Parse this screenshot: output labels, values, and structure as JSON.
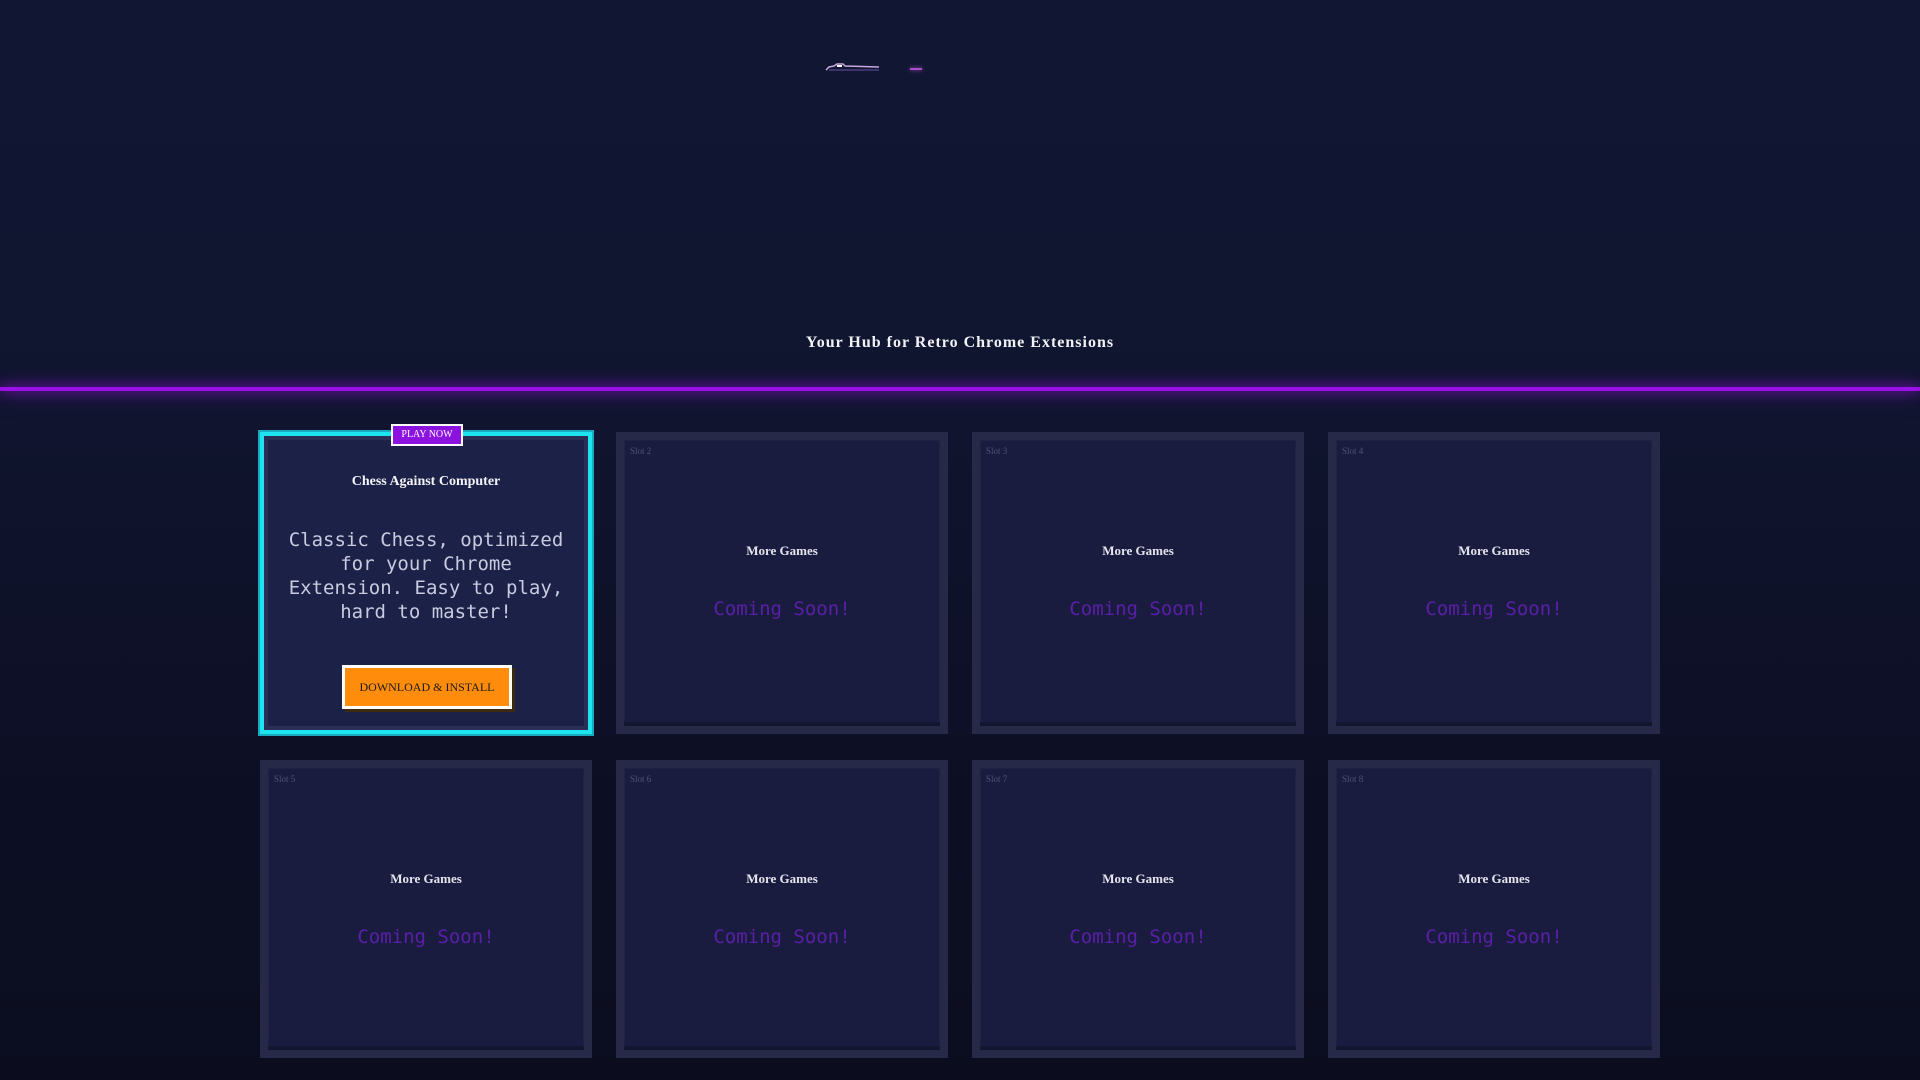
{
  "header": {
    "tagline": "Your Hub for Retro Chrome Extensions",
    "logo_icon": "car-logo-icon"
  },
  "colors": {
    "background": "#111633",
    "accent_purple": "#9b10e6",
    "featured_border": "#1ee3f0",
    "button_orange": "#ff8c0a",
    "coming_soon": "#5b1fa8"
  },
  "featured_game": {
    "badge": "PLAY NOW",
    "title": "Chess Against Computer",
    "description": "Classic Chess, optimized for your Chrome Extension. Easy to play, hard to master!",
    "button_label": "DOWNLOAD & INSTALL"
  },
  "slots": [
    {
      "label": "Slot 2",
      "title": "More Games",
      "status": "Coming Soon!"
    },
    {
      "label": "Slot 3",
      "title": "More Games",
      "status": "Coming Soon!"
    },
    {
      "label": "Slot 4",
      "title": "More Games",
      "status": "Coming Soon!"
    },
    {
      "label": "Slot 5",
      "title": "More Games",
      "status": "Coming Soon!"
    },
    {
      "label": "Slot 6",
      "title": "More Games",
      "status": "Coming Soon!"
    },
    {
      "label": "Slot 7",
      "title": "More Games",
      "status": "Coming Soon!"
    },
    {
      "label": "Slot 8",
      "title": "More Games",
      "status": "Coming Soon!"
    }
  ]
}
